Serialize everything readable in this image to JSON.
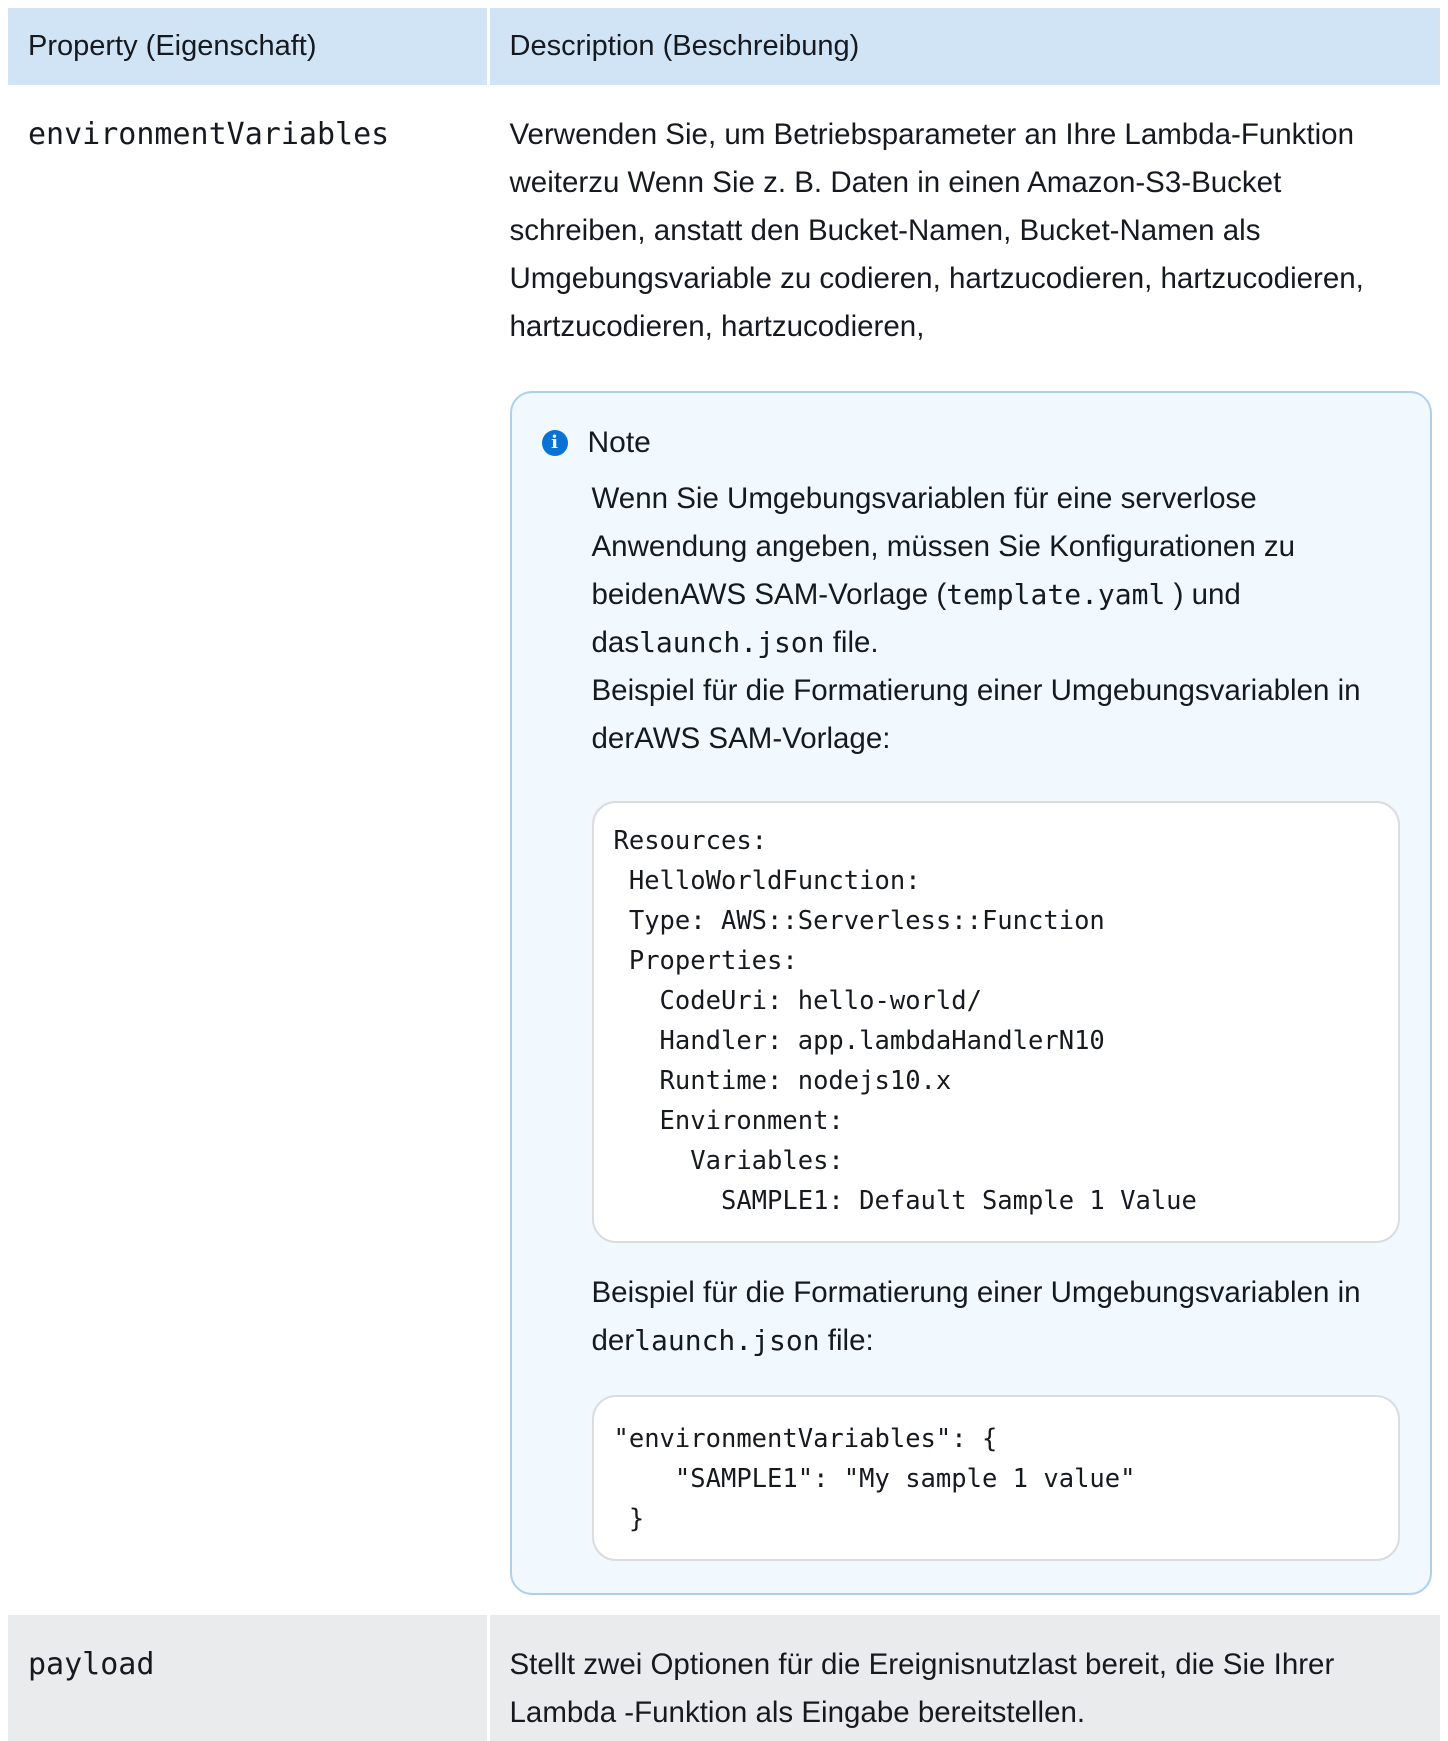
{
  "table": {
    "headers": {
      "property": "Property (Eigenschaft)",
      "description": "Description (Beschreibung)"
    },
    "rows": [
      {
        "property": "environmentVariables",
        "description": "Verwenden Sie, um Betriebsparameter an Ihre Lambda-Funktion weiterzu Wenn Sie z. B. Daten in einen Amazon-S3-Bucket schreiben, anstatt den Bucket-Namen, Bucket-Namen als Umgebungsvariable zu codieren, hartzucodieren, hartzucodieren, hartzucodieren, hartzucodieren,",
        "note": {
          "icon": "info-icon",
          "title": "Note",
          "p1_before": "Wenn Sie Umgebungsvariablen für eine serverlose Anwendung angeben, müssen Sie Konfigurationen zu beidenAWS SAM-Vorlage (",
          "p1_code1": "template.yaml",
          "p1_mid": " ) und das",
          "p1_code2": "launch.json",
          "p1_after": " file.",
          "p2": "Beispiel für die Formatierung einer Umgebungsvariablen in derAWS SAM-Vorlage:",
          "code_yaml": "Resources:\n HelloWorldFunction:\n Type: AWS::Serverless::Function\n Properties:\n   CodeUri: hello-world/\n   Handler: app.lambdaHandlerN10\n   Runtime: nodejs10.x\n   Environment:\n     Variables:\n       SAMPLE1: Default Sample 1 Value",
          "p3_before": "Beispiel für die Formatierung einer Umgebungsvariablen in der",
          "p3_code": "launch.json",
          "p3_after": " file:",
          "code_json": "\"environmentVariables\": {\n    \"SAMPLE1\": \"My sample 1 value\"\n }"
        }
      },
      {
        "property": "payload",
        "description": "Stellt zwei Optionen für die Ereignisnutzlast bereit, die Sie Ihrer Lambda -Funktion als Eingabe bereitstellen."
      }
    ]
  },
  "colors": {
    "header_bg": "#d1e4f5",
    "note_bg": "#f1f8fe",
    "note_border": "#aed0ee",
    "info_icon": "#0972d3",
    "alt_row_bg": "#e9ebed"
  }
}
